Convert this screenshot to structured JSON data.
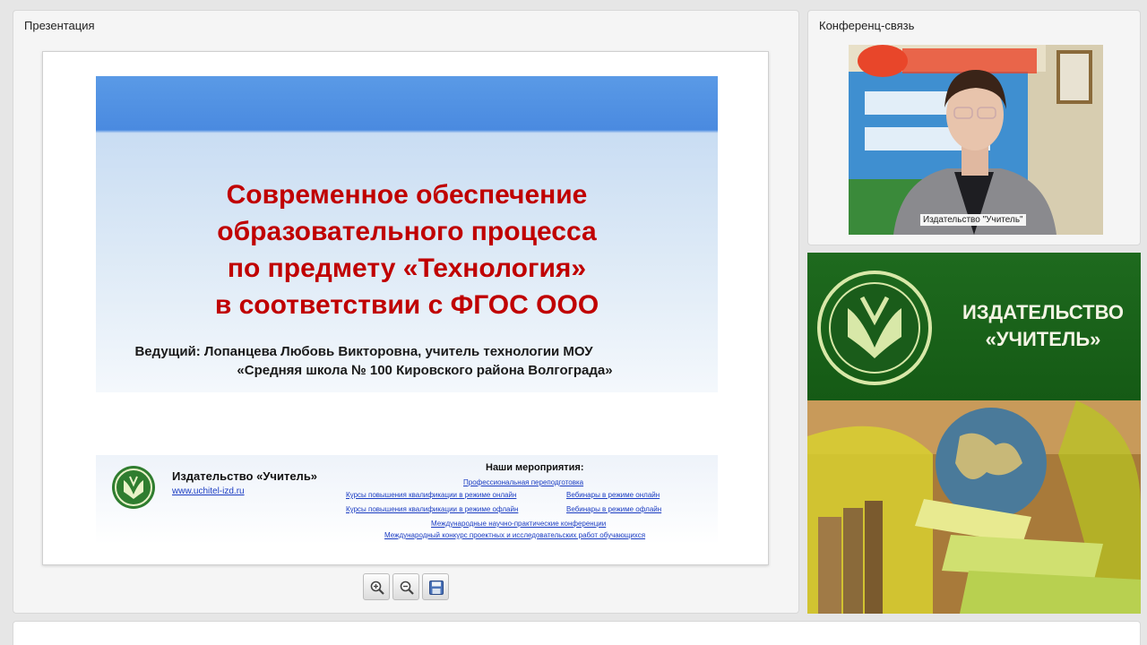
{
  "presentation_panel": {
    "title": "Презентация",
    "slide": {
      "title_lines": [
        "Современное обеспечение",
        "образовательного процесса",
        "по предмету «Технология»",
        "в соответствии с ФГОС ООО"
      ],
      "presenter_line1": "Ведущий: Лопанцева Любовь Викторовна, учитель технологии МОУ",
      "presenter_line2": "«Средняя школа № 100 Кировского района Волгограда»",
      "footer": {
        "publisher_name": "Издательство «Учитель»",
        "publisher_url": "www.uchitel-izd.ru",
        "events_heading": "Наши мероприятия:",
        "events": [
          "Профессиональная переподготовка",
          "Курсы повышения квалификации в режиме онлайн",
          "Вебинары в режиме онлайн",
          "Курсы повышения квалификации в режиме офлайн",
          "Вебинары в режиме офлайн",
          "Международные научно-практические конференции",
          "Международный конкурс проектных и исследовательских работ обучающихся"
        ]
      }
    },
    "toolbar": {
      "zoom_in_icon": "zoom-in-icon",
      "zoom_out_icon": "zoom-out-icon",
      "save_icon": "save-icon"
    }
  },
  "conference_panel": {
    "title": "Конференц-связь",
    "video_label": "Издательство \"Учитель\""
  },
  "publisher_banner": {
    "name_line1": "ИЗДАТЕЛЬСТВО",
    "name_line2": "«УЧИТЕЛЬ»"
  },
  "colors": {
    "slide_title": "#c00000",
    "banner_green": "#1e6a1e",
    "link_blue": "#1a3cc2"
  }
}
